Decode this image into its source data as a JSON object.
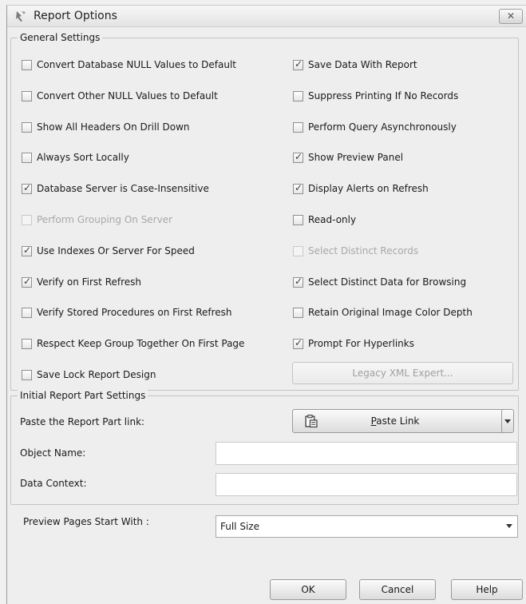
{
  "window": {
    "title": "Report Options",
    "close_glyph": "✕"
  },
  "general": {
    "legend": "General Settings",
    "left": [
      {
        "label": "Convert Database NULL Values to Default",
        "checked": false,
        "disabled": false
      },
      {
        "label": "Convert Other NULL Values to Default",
        "checked": false,
        "disabled": false
      },
      {
        "label": "Show All Headers On Drill Down",
        "checked": false,
        "disabled": false
      },
      {
        "label": "Always Sort Locally",
        "checked": false,
        "disabled": false
      },
      {
        "label": "Database Server is Case-Insensitive",
        "checked": true,
        "disabled": false
      },
      {
        "label": "Perform Grouping On Server",
        "checked": false,
        "disabled": true
      },
      {
        "label": "Use Indexes Or Server For Speed",
        "checked": true,
        "disabled": false
      },
      {
        "label": "Verify on First Refresh",
        "checked": true,
        "disabled": false
      },
      {
        "label": "Verify Stored Procedures on First Refresh",
        "checked": false,
        "disabled": false
      },
      {
        "label": "Respect Keep Group Together On First Page",
        "checked": false,
        "disabled": false
      },
      {
        "label": "Save Lock Report Design",
        "checked": false,
        "disabled": false
      }
    ],
    "right": [
      {
        "label": "Save Data With Report",
        "checked": true,
        "disabled": false
      },
      {
        "label": "Suppress Printing If No Records",
        "checked": false,
        "disabled": false
      },
      {
        "label": "Perform Query Asynchronously",
        "checked": false,
        "disabled": false
      },
      {
        "label": "Show Preview Panel",
        "checked": true,
        "disabled": false
      },
      {
        "label": "Display Alerts on Refresh",
        "checked": true,
        "disabled": false
      },
      {
        "label": "Read-only",
        "checked": false,
        "disabled": false
      },
      {
        "label": "Select Distinct Records",
        "checked": false,
        "disabled": true
      },
      {
        "label": "Select Distinct Data for Browsing",
        "checked": true,
        "disabled": false
      },
      {
        "label": "Retain Original Image Color Depth",
        "checked": false,
        "disabled": false
      },
      {
        "label": "Prompt For Hyperlinks",
        "checked": true,
        "disabled": false
      }
    ],
    "legacy_button": "Legacy XML Expert..."
  },
  "report_part": {
    "legend": "Initial Report Part Settings",
    "paste_label": "Paste the Report Part link:",
    "paste_button_prefix": "",
    "paste_button_hotkey": "P",
    "paste_button_rest": "aste Link",
    "paste_icon": "clipboard-icon",
    "object_name_label": "Object Name:",
    "object_name_value": "",
    "data_context_label": "Data Context:",
    "data_context_value": ""
  },
  "preview": {
    "label": "Preview Pages Start With :",
    "selected": "Full Size"
  },
  "buttons": {
    "ok": "OK",
    "cancel": "Cancel",
    "help": "Help"
  }
}
